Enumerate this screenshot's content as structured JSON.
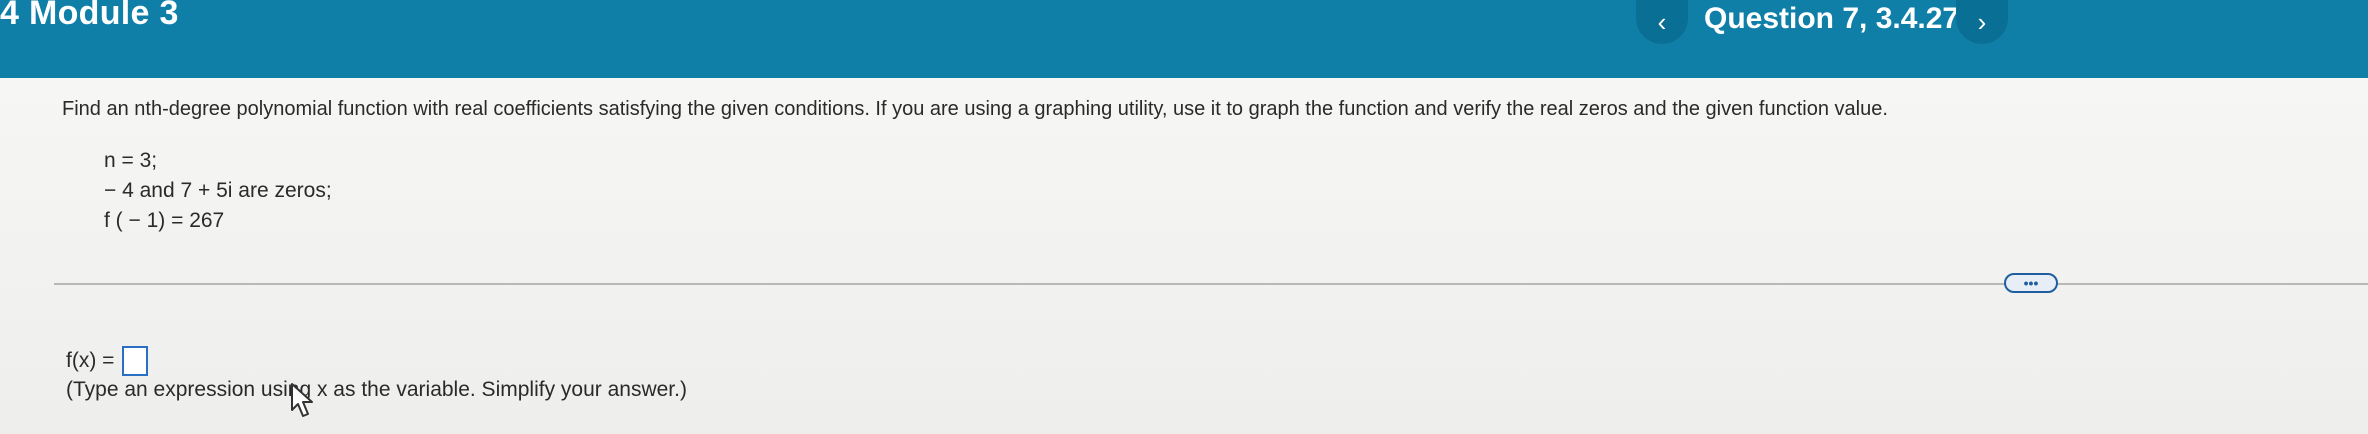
{
  "header": {
    "module_title": "4 Module 3",
    "question_title": "Question 7, 3.4.27",
    "prev_label": "‹",
    "next_label": "›"
  },
  "problem": {
    "instructions": "Find an nth-degree polynomial function with real coefficients satisfying the given conditions. If you are using a graphing utility, use it to graph the function and verify the real zeros and the given function value.",
    "conditions": [
      "n = 3;",
      "− 4 and 7 + 5i are zeros;",
      "f ( − 1) = 267"
    ],
    "more_label": "•••"
  },
  "answer": {
    "label": "f(x) =",
    "value": "",
    "hint": "(Type an expression using x as the variable. Simplify your answer.)"
  },
  "colors": {
    "header_bg": "#0f7fa8",
    "nav_bg": "#0a6f94",
    "input_border": "#2a6fc2"
  }
}
